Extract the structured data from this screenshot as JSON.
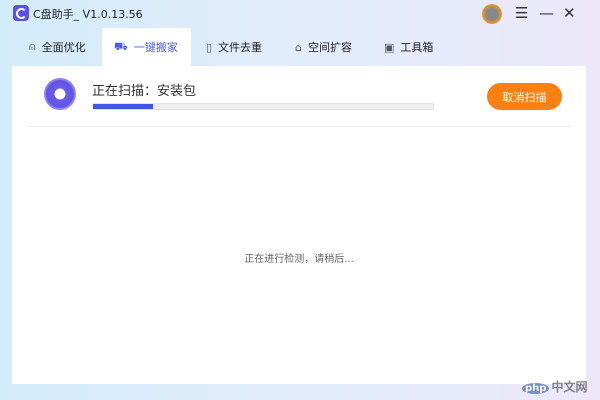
{
  "app": {
    "title": "C盘助手_ V1.0.13.56"
  },
  "window_controls": {
    "menu": "☰",
    "minimize": "—",
    "close": "✕"
  },
  "tabs": [
    {
      "label": "全面优化",
      "icon": "rocket-icon",
      "glyph": "⍝"
    },
    {
      "label": "一键搬家",
      "icon": "truck-icon",
      "glyph": "⛟",
      "active": true
    },
    {
      "label": "文件去重",
      "icon": "file-icon",
      "glyph": "▯"
    },
    {
      "label": "空间扩容",
      "icon": "expand-icon",
      "glyph": "⌂"
    },
    {
      "label": "工具箱",
      "icon": "toolbox-icon",
      "glyph": "▣"
    }
  ],
  "scan": {
    "title": "正在扫描：安装包",
    "progress_percent": 17.6,
    "cancel_label": "取消扫描"
  },
  "status_message": "正在进行检测，请稍后...",
  "watermark": "php 中文网",
  "colors": {
    "accent": "#4355e8",
    "cancel": "#ff8012"
  }
}
